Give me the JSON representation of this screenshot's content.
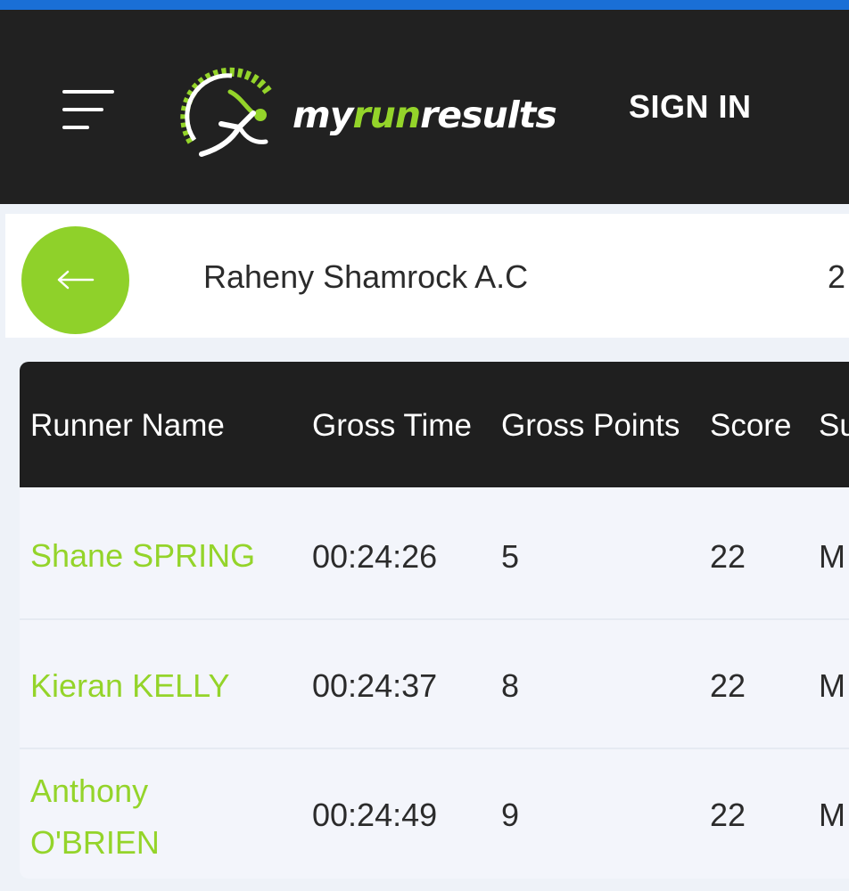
{
  "header": {
    "logo_prefix": "my",
    "logo_run": "run",
    "logo_suffix": "results",
    "sign_in_label": "SIGN IN"
  },
  "club": {
    "name": "Raheny Shamrock A.C",
    "extra": "2"
  },
  "table": {
    "columns": [
      "Runner Name",
      "Gross Time",
      "Gross Points",
      "Score",
      "Su"
    ],
    "rows": [
      {
        "name": "Shane SPRING",
        "time": "00:24:26",
        "points": "5",
        "score": "22",
        "sub": "M"
      },
      {
        "name": "Kieran KELLY",
        "time": "00:24:37",
        "points": "8",
        "score": "22",
        "sub": "M"
      },
      {
        "name": "Anthony O'BRIEN",
        "time": "00:24:49",
        "points": "9",
        "score": "22",
        "sub": "M"
      }
    ]
  },
  "colors": {
    "accent_green": "#94d42a",
    "header_bg": "#212121",
    "top_strip": "#1a6fd6"
  },
  "icons": [
    "hamburger-menu-icon",
    "runner-logo-icon",
    "back-arrow-icon"
  ]
}
